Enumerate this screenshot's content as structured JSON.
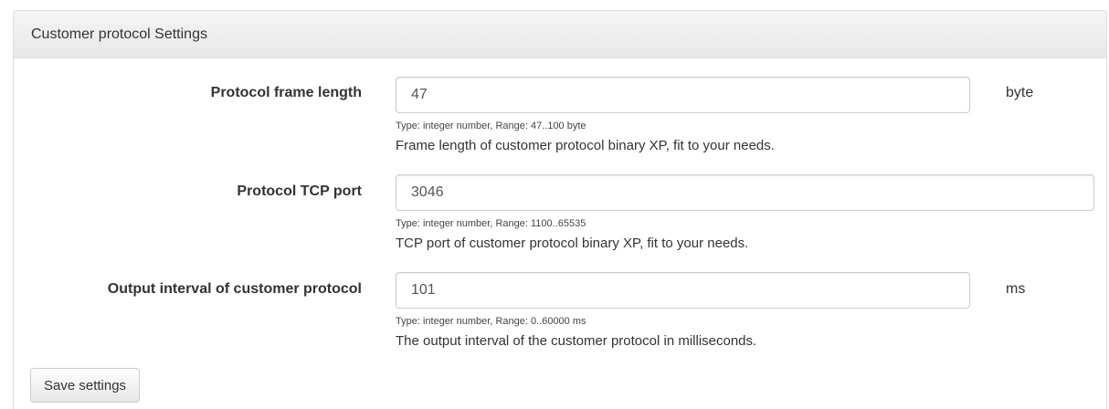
{
  "panel": {
    "title": "Customer protocol Settings"
  },
  "fields": [
    {
      "label": "Protocol frame length",
      "value": "47",
      "unit": "byte",
      "hint": "Type: integer number, Range: 47..100 byte",
      "description": "Frame length of customer protocol binary XP, fit to your needs."
    },
    {
      "label": "Protocol TCP port",
      "value": "3046",
      "unit": "",
      "hint": "Type: integer number, Range: 1100..65535",
      "description": "TCP port of customer protocol binary XP, fit to your needs."
    },
    {
      "label": "Output interval of customer protocol",
      "value": "101",
      "unit": "ms",
      "hint": "Type: integer number, Range: 0..60000 ms",
      "description": "The output interval of the customer protocol in milliseconds."
    }
  ],
  "actions": {
    "save_label": "Save settings"
  }
}
